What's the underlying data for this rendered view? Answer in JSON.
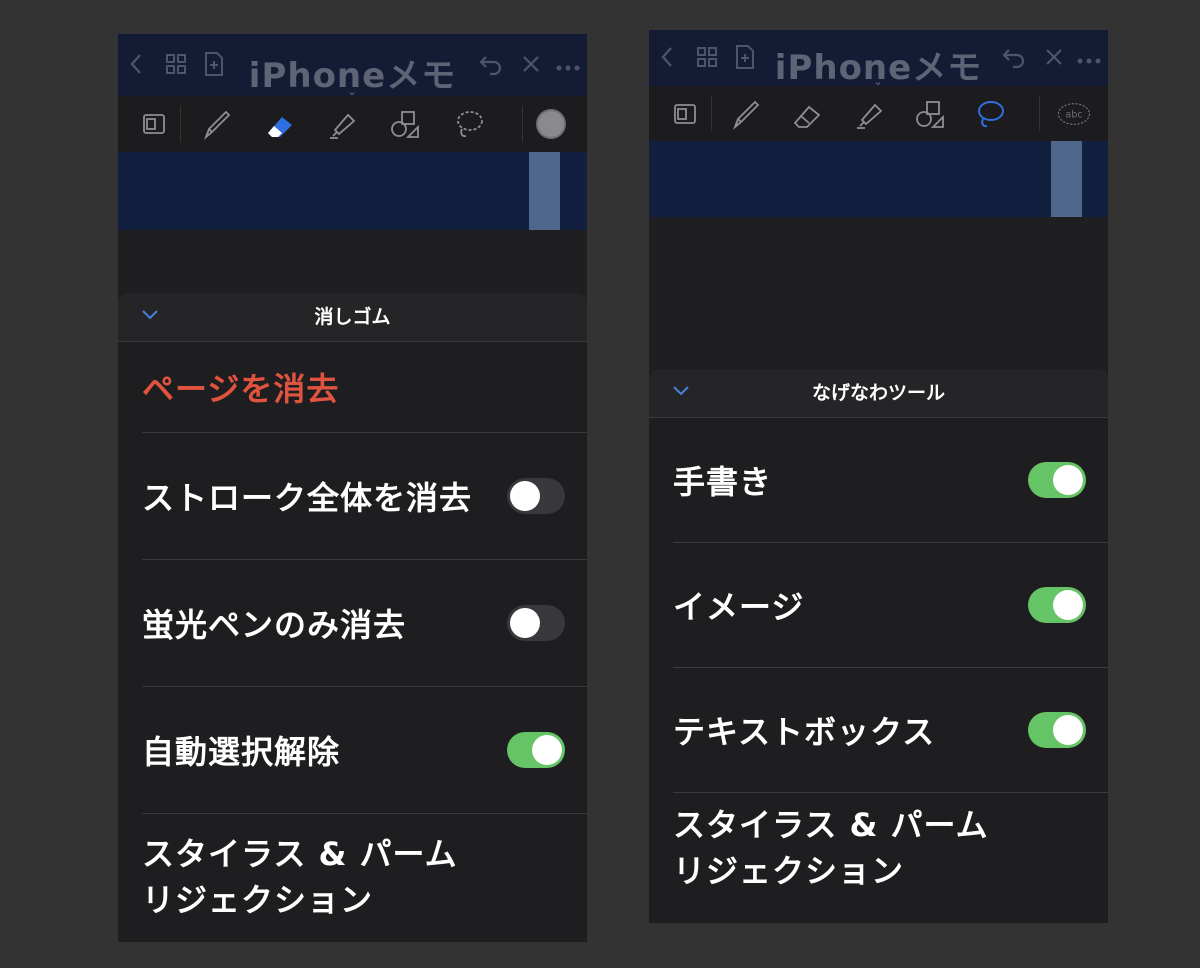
{
  "left": {
    "app_title": "iPhoneメモ",
    "panel_title": "消しゴム",
    "clear_page": "ページを消去",
    "rows": [
      {
        "label": "ストローク全体を消去",
        "on": false
      },
      {
        "label": "蛍光ペンのみ消去",
        "on": false
      },
      {
        "label": "自動選択解除",
        "on": true
      }
    ],
    "stylus_line1": "スタイラス & パーム",
    "stylus_line2": "リジェクション"
  },
  "right": {
    "app_title": "iPhoneメモ",
    "panel_title": "なげなわツール",
    "rows": [
      {
        "label": "手書き",
        "on": true
      },
      {
        "label": "イメージ",
        "on": true
      },
      {
        "label": "テキストボックス",
        "on": true
      }
    ],
    "stylus_line1": "スタイラス & パーム",
    "stylus_line2": "リジェクション",
    "text_tool_label": "abc"
  },
  "icons": {
    "back": "chevron-left-icon",
    "grid": "grid-icon",
    "new_page": "new-page-icon",
    "undo": "undo-icon",
    "close": "close-icon",
    "more": "more-icon"
  },
  "colors": {
    "accent": "#4a7fe0",
    "danger": "#e0533f",
    "toggle_on": "#65c466",
    "title_bar": "#141b34"
  }
}
